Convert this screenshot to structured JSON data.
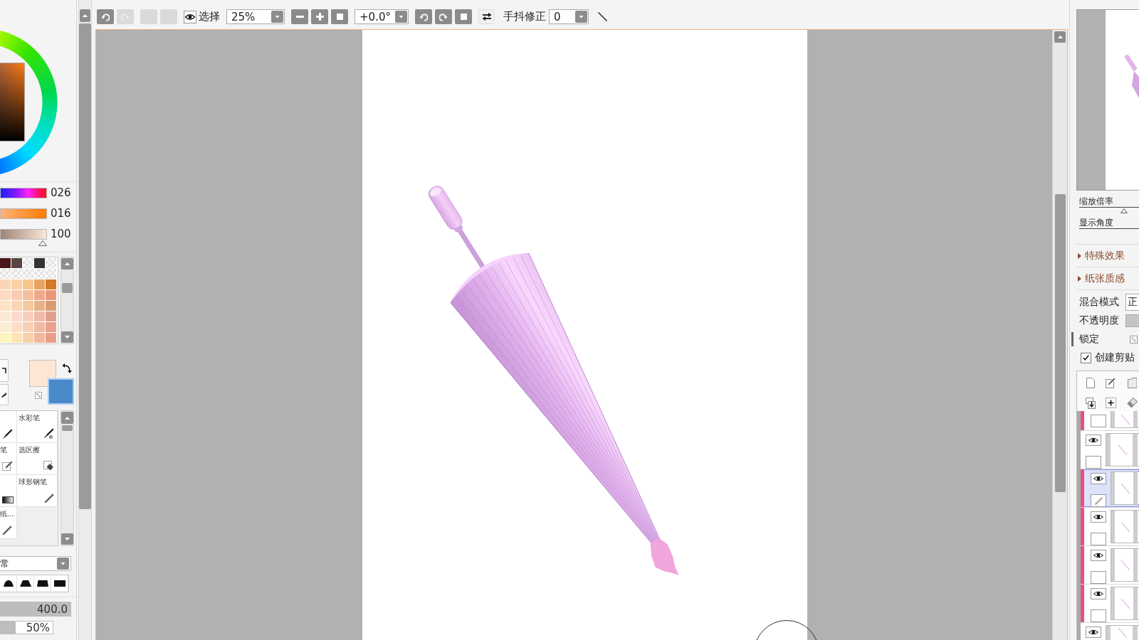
{
  "toolbar": {
    "groups": [
      [
        {
          "kind": "undo",
          "disabled": false
        },
        {
          "kind": "redo",
          "disabled": true
        }
      ],
      [
        {
          "kind": "blank",
          "disabled": true
        },
        {
          "kind": "blank",
          "disabled": true
        }
      ],
      [
        {
          "kind": "eyetoggle",
          "label": "选择"
        }
      ],
      [
        {
          "kind": "dropdown",
          "value": "25%"
        }
      ],
      [
        {
          "kind": "minus",
          "disabled": false
        },
        {
          "kind": "plus",
          "disabled": false
        },
        {
          "kind": "stop",
          "disabled": false
        }
      ],
      [
        {
          "kind": "dropdown",
          "value": "+0.0°"
        }
      ],
      [
        {
          "kind": "rotleft",
          "disabled": false
        },
        {
          "kind": "rotright",
          "disabled": false
        },
        {
          "kind": "stop",
          "disabled": false
        }
      ],
      [
        {
          "kind": "flip",
          "disabled": false
        }
      ],
      [
        {
          "kind": "label",
          "text": "手抖修正"
        },
        {
          "kind": "dropdown",
          "value": "0"
        }
      ],
      [
        {
          "kind": "stroke",
          "disabled": false
        }
      ]
    ]
  },
  "color_panel": {
    "sliders": [
      {
        "kind": "hue",
        "value": "026"
      },
      {
        "kind": "saturation",
        "value": "016"
      },
      {
        "kind": "brightness",
        "value": "100",
        "level": 1
      }
    ],
    "palette": [
      [
        {
          "kind": "color",
          "color": "#4a1818"
        },
        {
          "kind": "color",
          "color": "#584542"
        },
        {
          "kind": "empty"
        },
        {
          "kind": "color",
          "color": "#333333"
        },
        {
          "kind": "empty"
        }
      ],
      [
        {
          "kind": "empty"
        },
        {
          "kind": "empty"
        },
        {
          "kind": "empty"
        },
        {
          "kind": "empty"
        },
        {
          "kind": "empty"
        }
      ],
      [
        {
          "kind": "color",
          "color": "#fbd6b4"
        },
        {
          "kind": "color",
          "color": "#fcd0a4"
        },
        {
          "kind": "color",
          "color": "#f8c58c"
        },
        {
          "kind": "color",
          "color": "#e8a462"
        },
        {
          "kind": "color",
          "color": "#d27a26"
        }
      ],
      [
        {
          "kind": "color",
          "color": "#fcdac4"
        },
        {
          "kind": "color",
          "color": "#f9cdb2"
        },
        {
          "kind": "color",
          "color": "#f6bfa0"
        },
        {
          "kind": "color",
          "color": "#efa98a"
        },
        {
          "kind": "color",
          "color": "#e9987c"
        }
      ],
      [
        {
          "kind": "color",
          "color": "#fde2c4"
        },
        {
          "kind": "color",
          "color": "#fbd6b2"
        },
        {
          "kind": "color",
          "color": "#f4caa2"
        },
        {
          "kind": "color",
          "color": "#e6b28a"
        },
        {
          "kind": "color",
          "color": "#d79c72"
        }
      ],
      [
        {
          "kind": "color",
          "color": "#fde8d8"
        },
        {
          "kind": "color",
          "color": "#fbdccc"
        },
        {
          "kind": "color",
          "color": "#f8cebe"
        },
        {
          "kind": "color",
          "color": "#f2baa8"
        },
        {
          "kind": "color",
          "color": "#dea08a"
        }
      ],
      [
        {
          "kind": "color",
          "color": "#fdecd2"
        },
        {
          "kind": "color",
          "color": "#fcdec6"
        },
        {
          "kind": "color",
          "color": "#f7cfb6"
        },
        {
          "kind": "color",
          "color": "#f1b8a2"
        },
        {
          "kind": "color",
          "color": "#e9a08c"
        }
      ],
      [
        {
          "kind": "color",
          "color": "#fef4c0"
        },
        {
          "kind": "color",
          "color": "#fce4b4"
        },
        {
          "kind": "color",
          "color": "#f8d0a8"
        },
        {
          "kind": "color",
          "color": "#f0b89e"
        },
        {
          "kind": "color",
          "color": "#ea9e88"
        }
      ]
    ],
    "colors": [
      {
        "kind": "foreground",
        "color": "#fde6d4",
        "selected": false
      },
      {
        "kind": "background",
        "color": "#4a8acb",
        "selected": true
      }
    ]
  },
  "brushes": [
    {
      "kind": "pen"
    },
    {
      "kind": "watercolor",
      "label": "水彩笔"
    },
    {
      "kind": "selpen",
      "label": "笔"
    },
    {
      "kind": "seleraser",
      "label": "选区擦"
    },
    {
      "kind": "gradient"
    },
    {
      "kind": "pencil",
      "label": "球形钢笔"
    },
    {
      "kind": "pencil",
      "label": "纸..."
    }
  ],
  "brush_settings": {
    "blend_mode": "常",
    "size": {
      "value": "400.0",
      "level": 1
    },
    "density": {
      "value": "50%",
      "level": 0.3
    }
  },
  "navigator": {
    "sliders": [
      {
        "label": "缩放倍率",
        "level": 0.75
      },
      {
        "label": "显示角度"
      }
    ]
  },
  "sections": [
    {
      "label": "特殊效果",
      "expanded": false
    },
    {
      "label": "纸张质感",
      "expanded": false
    }
  ],
  "layer_properties": {
    "blend_mode": {
      "label": "混合模式",
      "value": "正"
    },
    "opacity": {
      "label": "不透明度"
    },
    "lock": {
      "label": "锁定"
    },
    "clipping": {
      "label": "创建剪贴",
      "checked": true
    }
  },
  "layers": [
    {
      "kind": "cuttop",
      "clipped": true,
      "selected": false
    },
    {
      "kind": "full",
      "clipped": false,
      "selected": false,
      "visible": true
    },
    {
      "kind": "full",
      "clipped": true,
      "selected": true,
      "visible": true
    },
    {
      "kind": "full",
      "clipped": true,
      "selected": false,
      "visible": true
    },
    {
      "kind": "full",
      "clipped": true,
      "selected": false,
      "visible": true
    },
    {
      "kind": "full",
      "clipped": true,
      "selected": false,
      "visible": true
    },
    {
      "kind": "cutbottom",
      "clipped": false,
      "selected": false,
      "visible": true
    }
  ]
}
